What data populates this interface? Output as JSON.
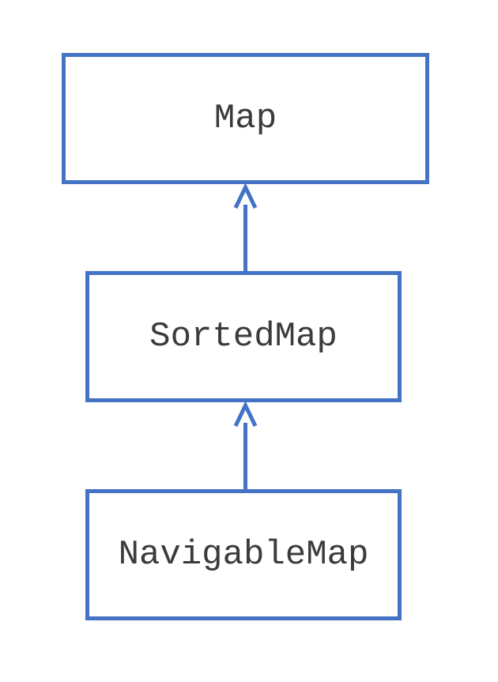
{
  "diagram": {
    "nodes": {
      "map": {
        "label": "Map"
      },
      "sortedmap": {
        "label": "SortedMap"
      },
      "navigablemap": {
        "label": "NavigableMap"
      }
    },
    "edges": [
      {
        "from": "SortedMap",
        "to": "Map"
      },
      {
        "from": "NavigableMap",
        "to": "SortedMap"
      }
    ],
    "colors": {
      "stroke": "#4472c4",
      "text": "#3b3b3b"
    }
  }
}
